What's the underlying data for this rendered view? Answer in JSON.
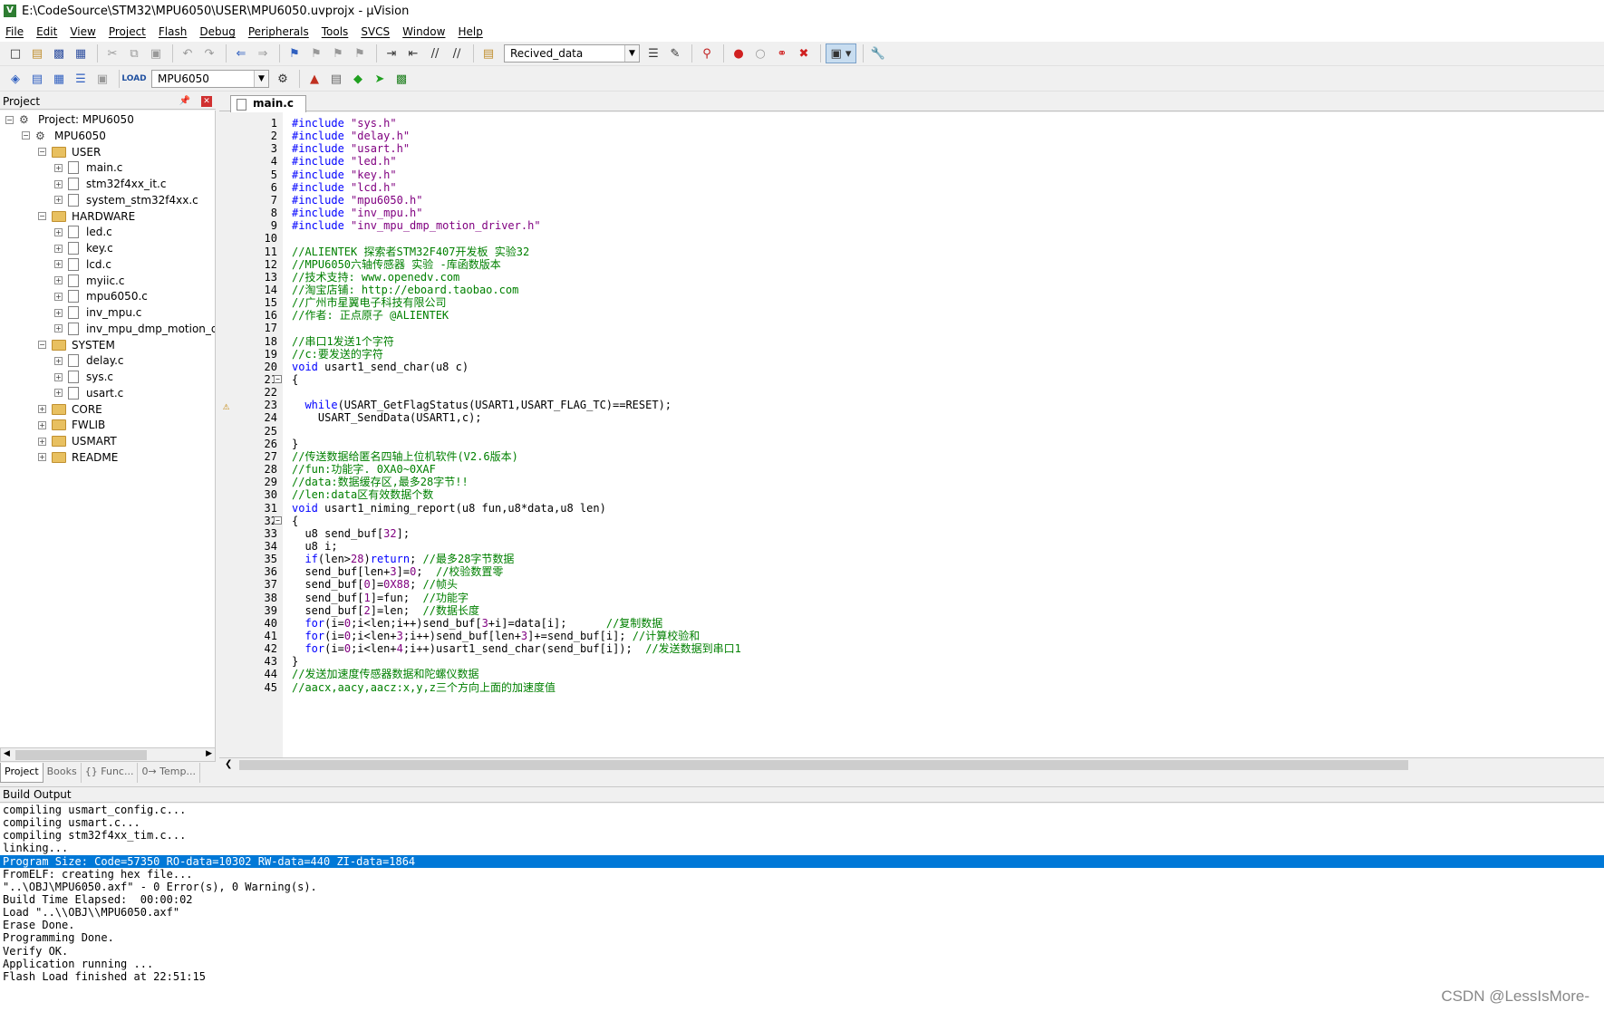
{
  "window": {
    "title": "E:\\CodeSource\\STM32\\MPU6050\\USER\\MPU6050.uvprojx - µVision"
  },
  "menu": [
    "File",
    "Edit",
    "View",
    "Project",
    "Flash",
    "Debug",
    "Peripherals",
    "Tools",
    "SVCS",
    "Window",
    "Help"
  ],
  "toolbar": {
    "find_combo": "Recived_data",
    "target_combo": "MPU6050"
  },
  "project_panel": {
    "title": "Project",
    "tree": [
      {
        "label": "Project: MPU6050",
        "type": "project",
        "level": 0
      },
      {
        "label": "MPU6050",
        "type": "target",
        "level": 1
      },
      {
        "label": "USER",
        "type": "folder",
        "level": 2
      },
      {
        "label": "main.c",
        "type": "file",
        "level": 3
      },
      {
        "label": "stm32f4xx_it.c",
        "type": "file",
        "level": 3
      },
      {
        "label": "system_stm32f4xx.c",
        "type": "file",
        "level": 3
      },
      {
        "label": "HARDWARE",
        "type": "folder",
        "level": 2
      },
      {
        "label": "led.c",
        "type": "file",
        "level": 3
      },
      {
        "label": "key.c",
        "type": "file",
        "level": 3
      },
      {
        "label": "lcd.c",
        "type": "file",
        "level": 3
      },
      {
        "label": "myiic.c",
        "type": "file",
        "level": 3
      },
      {
        "label": "mpu6050.c",
        "type": "file",
        "level": 3
      },
      {
        "label": "inv_mpu.c",
        "type": "file",
        "level": 3
      },
      {
        "label": "inv_mpu_dmp_motion_d",
        "type": "file",
        "level": 3
      },
      {
        "label": "SYSTEM",
        "type": "folder",
        "level": 2
      },
      {
        "label": "delay.c",
        "type": "file",
        "level": 3
      },
      {
        "label": "sys.c",
        "type": "file",
        "level": 3
      },
      {
        "label": "usart.c",
        "type": "file",
        "level": 3
      },
      {
        "label": "CORE",
        "type": "folder",
        "level": 2
      },
      {
        "label": "FWLIB",
        "type": "folder",
        "level": 2
      },
      {
        "label": "USMART",
        "type": "folder",
        "level": 2
      },
      {
        "label": "README",
        "type": "folder",
        "level": 2
      }
    ],
    "tabs": [
      "Project",
      "Books",
      "{} Func...",
      "0→ Temp..."
    ]
  },
  "editor": {
    "tab": "main.c",
    "lines": [
      {
        "n": "1",
        "t": "#include \"sys.h\"",
        "c": "pp"
      },
      {
        "n": "2",
        "t": "#include \"delay.h\"",
        "c": "pp"
      },
      {
        "n": "3",
        "t": "#include \"usart.h\"",
        "c": "pp"
      },
      {
        "n": "4",
        "t": "#include \"led.h\"",
        "c": "pp"
      },
      {
        "n": "5",
        "t": "#include \"key.h\"",
        "c": "pp"
      },
      {
        "n": "6",
        "t": "#include \"lcd.h\"",
        "c": "pp"
      },
      {
        "n": "7",
        "t": "#include \"mpu6050.h\"",
        "c": "pp"
      },
      {
        "n": "8",
        "t": "#include \"inv_mpu.h\"",
        "c": "pp"
      },
      {
        "n": "9",
        "t": "#include \"inv_mpu_dmp_motion_driver.h\"",
        "c": "pp"
      },
      {
        "n": "10",
        "t": "",
        "c": ""
      },
      {
        "n": "11",
        "t": "//ALIENTEK 探索者STM32F407开发板 实验32",
        "c": "cmt"
      },
      {
        "n": "12",
        "t": "//MPU6050六轴传感器 实验 -库函数版本",
        "c": "cmt"
      },
      {
        "n": "13",
        "t": "//技术支持: www.openedv.com",
        "c": "cmt"
      },
      {
        "n": "14",
        "t": "//淘宝店铺: http://eboard.taobao.com",
        "c": "cmt"
      },
      {
        "n": "15",
        "t": "//广州市星翼电子科技有限公司",
        "c": "cmt"
      },
      {
        "n": "16",
        "t": "//作者: 正点原子 @ALIENTEK",
        "c": "cmt"
      },
      {
        "n": "17",
        "t": "",
        "c": ""
      },
      {
        "n": "18",
        "t": "//串口1发送1个字符",
        "c": "cmt"
      },
      {
        "n": "19",
        "t": "//c:要发送的字符",
        "c": "cmt"
      },
      {
        "n": "20",
        "t": "void usart1_send_char(u8 c)",
        "c": "fn"
      },
      {
        "n": "21",
        "t": "{",
        "c": "",
        "fold": true
      },
      {
        "n": "22",
        "t": "",
        "c": ""
      },
      {
        "n": "23",
        "t": "  while(USART_GetFlagStatus(USART1,USART_FLAG_TC)==RESET);",
        "c": "while",
        "warn": true
      },
      {
        "n": "24",
        "t": "    USART_SendData(USART1,c);",
        "c": ""
      },
      {
        "n": "25",
        "t": "",
        "c": ""
      },
      {
        "n": "26",
        "t": "}",
        "c": ""
      },
      {
        "n": "27",
        "t": "//传送数据给匿名四轴上位机软件(V2.6版本)",
        "c": "cmt"
      },
      {
        "n": "28",
        "t": "//fun:功能字. 0XA0~0XAF",
        "c": "cmt"
      },
      {
        "n": "29",
        "t": "//data:数据缓存区,最多28字节!!",
        "c": "cmt"
      },
      {
        "n": "30",
        "t": "//len:data区有效数据个数",
        "c": "cmt"
      },
      {
        "n": "31",
        "t": "void usart1_niming_report(u8 fun,u8*data,u8 len)",
        "c": "fn"
      },
      {
        "n": "32",
        "t": "{",
        "c": "",
        "fold": true
      },
      {
        "n": "33",
        "t": "  u8 send_buf[32];",
        "c": ""
      },
      {
        "n": "34",
        "t": "  u8 i;",
        "c": ""
      },
      {
        "n": "35",
        "t": "  if(len>28)return; //最多28字节数据",
        "c": "mix"
      },
      {
        "n": "36",
        "t": "  send_buf[len+3]=0;  //校验数置零",
        "c": "mix"
      },
      {
        "n": "37",
        "t": "  send_buf[0]=0X88; //帧头",
        "c": "mix"
      },
      {
        "n": "38",
        "t": "  send_buf[1]=fun;  //功能字",
        "c": "mix"
      },
      {
        "n": "39",
        "t": "  send_buf[2]=len;  //数据长度",
        "c": "mix"
      },
      {
        "n": "40",
        "t": "  for(i=0;i<len;i++)send_buf[3+i]=data[i];      //复制数据",
        "c": "mix"
      },
      {
        "n": "41",
        "t": "  for(i=0;i<len+3;i++)send_buf[len+3]+=send_buf[i]; //计算校验和",
        "c": "mix"
      },
      {
        "n": "42",
        "t": "  for(i=0;i<len+4;i++)usart1_send_char(send_buf[i]);  //发送数据到串口1",
        "c": "mix"
      },
      {
        "n": "43",
        "t": "}",
        "c": ""
      },
      {
        "n": "44",
        "t": "//发送加速度传感器数据和陀螺仪数据",
        "c": "cmt"
      },
      {
        "n": "45",
        "t": "//aacx,aacy,aacz:x,y,z三个方向上面的加速度值",
        "c": "cmt"
      }
    ]
  },
  "build_output": {
    "title": "Build Output",
    "lines": [
      "compiling usmart_config.c...",
      "compiling usmart.c...",
      "compiling stm32f4xx_tim.c...",
      "linking...",
      "Program Size: Code=57350 RO-data=10302 RW-data=440 ZI-data=1864",
      "FromELF: creating hex file...",
      "\"..\\OBJ\\MPU6050.axf\" - 0 Error(s), 0 Warning(s).",
      "Build Time Elapsed:  00:00:02",
      "Load \"..\\\\OBJ\\\\MPU6050.axf\"",
      "Erase Done.",
      "Programming Done.",
      "Verify OK.",
      "Application running ...",
      "Flash Load finished at 22:51:15"
    ],
    "selected_index": 4
  },
  "watermark": "CSDN @LessIsMore-"
}
